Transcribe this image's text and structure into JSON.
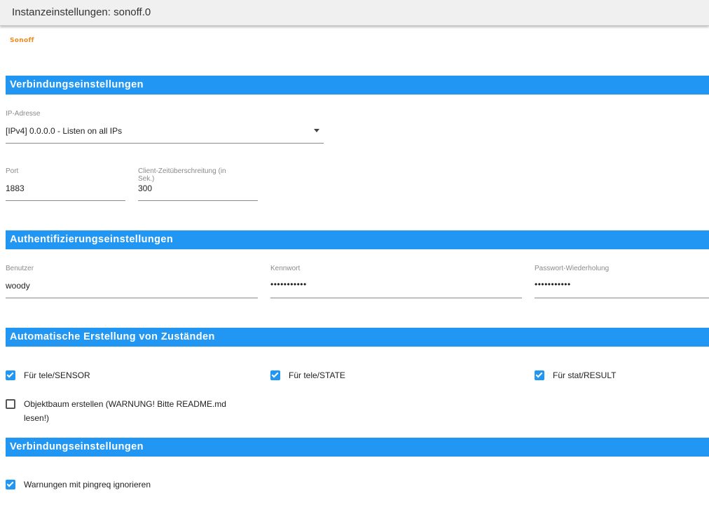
{
  "window": {
    "title": "Instanzeinstellungen: sonoff.0"
  },
  "logo": {
    "text": "Sonoff"
  },
  "sections": {
    "connection": "Verbindungseinstellungen",
    "auth": "Authentifizierungseinstellungen",
    "auto_states": "Automatische Erstellung von Zuständen",
    "connection2": "Verbindungseinstellungen"
  },
  "ip": {
    "label": "IP-Adresse",
    "value": "[IPv4] 0.0.0.0 - Listen on all IPs"
  },
  "port": {
    "label": "Port",
    "value": "1883"
  },
  "timeout": {
    "label": "Client-Zeitüberschreitung (in Sek.)",
    "value": "300"
  },
  "user": {
    "label": "Benutzer",
    "value": "woody"
  },
  "password": {
    "label": "Kennwort",
    "value": "•••••••••••"
  },
  "password_repeat": {
    "label": "Passwort-Wiederholung",
    "value": "•••••••••••"
  },
  "checkboxes": {
    "tele_sensor": {
      "label": "Für tele/SENSOR",
      "checked": true
    },
    "tele_state": {
      "label": "Für tele/STATE",
      "checked": true
    },
    "stat_result": {
      "label": "Für stat/RESULT",
      "checked": true
    },
    "object_tree": {
      "label": "Objektbaum erstellen (WARNUNG! Bitte README.md lesen!)",
      "checked": false
    },
    "ignore_pingreq": {
      "label": "Warnungen mit pingreq ignorieren",
      "checked": true
    }
  },
  "colors": {
    "accent": "#2196f3",
    "logo": "#f08a1c"
  }
}
